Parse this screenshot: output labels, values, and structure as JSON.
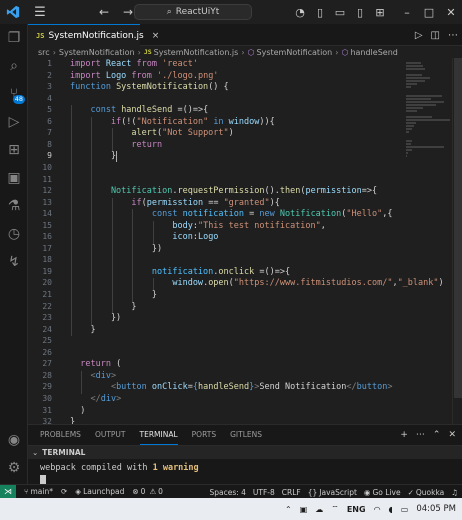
{
  "window": {
    "title": "ReactUiYt",
    "accent": "#0078d4"
  },
  "tab": {
    "lang_badge": "JS",
    "filename": "SystemNotification.js",
    "close_glyph": "×"
  },
  "breadcrumb": {
    "folder": "src",
    "file_a": "SystemNotification",
    "file_b": "SystemNotification.js",
    "fn": "SystemNotification",
    "method": "handleSend"
  },
  "activity_bar": {
    "source_control_badge": "48"
  },
  "editor": {
    "line_numbers": [
      "1",
      "2",
      "3",
      "4",
      "5",
      "6",
      "7",
      "8",
      "9",
      "10",
      "11",
      "12",
      "13",
      "14",
      "15",
      "16",
      "17",
      "18",
      "19",
      "20",
      "21",
      "22",
      "23",
      "24",
      "25",
      "26",
      "27",
      "28",
      "29",
      "30",
      "31",
      "32"
    ],
    "current_line": "9",
    "lines": [
      [
        {
          "t": "import ",
          "c": "#c586c0"
        },
        {
          "t": "React ",
          "c": "#9cdcfe"
        },
        {
          "t": "from ",
          "c": "#c586c0"
        },
        {
          "t": "'react'",
          "c": "#ce9178"
        }
      ],
      [
        {
          "t": "import ",
          "c": "#c586c0"
        },
        {
          "t": "Logo ",
          "c": "#9cdcfe"
        },
        {
          "t": "from ",
          "c": "#c586c0"
        },
        {
          "t": "'./logo.png'",
          "c": "#ce9178"
        }
      ],
      [
        {
          "t": "function ",
          "c": "#569cd6"
        },
        {
          "t": "SystemNotification",
          "c": "#dcdcaa"
        },
        {
          "t": "() {",
          "c": "#d4d4d4"
        }
      ],
      [],
      [
        {
          "t": "    const ",
          "c": "#569cd6"
        },
        {
          "t": "handleSend ",
          "c": "#dcdcaa"
        },
        {
          "t": "=()=>{",
          "c": "#d4d4d4"
        }
      ],
      [
        {
          "t": "        if",
          "c": "#c586c0"
        },
        {
          "t": "(!(",
          "c": "#d4d4d4"
        },
        {
          "t": "\"Notification\" ",
          "c": "#ce9178"
        },
        {
          "t": "in ",
          "c": "#569cd6"
        },
        {
          "t": "window",
          "c": "#9cdcfe"
        },
        {
          "t": ")){",
          "c": "#d4d4d4"
        }
      ],
      [
        {
          "t": "            alert",
          "c": "#dcdcaa"
        },
        {
          "t": "(",
          "c": "#d4d4d4"
        },
        {
          "t": "\"Not Support\"",
          "c": "#ce9178"
        },
        {
          "t": ")",
          "c": "#d4d4d4"
        }
      ],
      [
        {
          "t": "            return",
          "c": "#c586c0"
        }
      ],
      [
        {
          "t": "        }",
          "c": "#d4d4d4"
        }
      ],
      [],
      [],
      [
        {
          "t": "        Notification",
          "c": "#4ec9b0"
        },
        {
          "t": ".",
          "c": "#d4d4d4"
        },
        {
          "t": "requestPermission",
          "c": "#dcdcaa"
        },
        {
          "t": "().",
          "c": "#d4d4d4"
        },
        {
          "t": "then",
          "c": "#dcdcaa"
        },
        {
          "t": "(",
          "c": "#d4d4d4"
        },
        {
          "t": "permisstion",
          "c": "#9cdcfe"
        },
        {
          "t": "=>{",
          "c": "#d4d4d4"
        }
      ],
      [
        {
          "t": "            if",
          "c": "#c586c0"
        },
        {
          "t": "(",
          "c": "#d4d4d4"
        },
        {
          "t": "permisstion ",
          "c": "#9cdcfe"
        },
        {
          "t": "== ",
          "c": "#d4d4d4"
        },
        {
          "t": "\"granted\"",
          "c": "#ce9178"
        },
        {
          "t": "){",
          "c": "#d4d4d4"
        }
      ],
      [
        {
          "t": "                const ",
          "c": "#569cd6"
        },
        {
          "t": "notification ",
          "c": "#4fc1ff"
        },
        {
          "t": "= ",
          "c": "#d4d4d4"
        },
        {
          "t": "new ",
          "c": "#569cd6"
        },
        {
          "t": "Notification",
          "c": "#4ec9b0"
        },
        {
          "t": "(",
          "c": "#d4d4d4"
        },
        {
          "t": "\"Hello\"",
          "c": "#ce9178"
        },
        {
          "t": ",{",
          "c": "#d4d4d4"
        }
      ],
      [
        {
          "t": "                    body",
          "c": "#9cdcfe"
        },
        {
          "t": ":",
          "c": "#d4d4d4"
        },
        {
          "t": "\"This test notification\"",
          "c": "#ce9178"
        },
        {
          "t": ",",
          "c": "#d4d4d4"
        }
      ],
      [
        {
          "t": "                    icon",
          "c": "#9cdcfe"
        },
        {
          "t": ":",
          "c": "#d4d4d4"
        },
        {
          "t": "Logo",
          "c": "#9cdcfe"
        }
      ],
      [
        {
          "t": "                })",
          "c": "#d4d4d4"
        }
      ],
      [],
      [
        {
          "t": "                notification",
          "c": "#4fc1ff"
        },
        {
          "t": ".",
          "c": "#d4d4d4"
        },
        {
          "t": "onclick ",
          "c": "#dcdcaa"
        },
        {
          "t": "=()=>{",
          "c": "#d4d4d4"
        }
      ],
      [
        {
          "t": "                    window",
          "c": "#9cdcfe"
        },
        {
          "t": ".",
          "c": "#d4d4d4"
        },
        {
          "t": "open",
          "c": "#dcdcaa"
        },
        {
          "t": "(",
          "c": "#d4d4d4"
        },
        {
          "t": "\"https://www.fitmistudios.com/\"",
          "c": "#ce9178"
        },
        {
          "t": ",",
          "c": "#d4d4d4"
        },
        {
          "t": "\"_blank\"",
          "c": "#ce9178"
        },
        {
          "t": ")",
          "c": "#d4d4d4"
        }
      ],
      [
        {
          "t": "                }",
          "c": "#d4d4d4"
        }
      ],
      [
        {
          "t": "            }",
          "c": "#d4d4d4"
        }
      ],
      [
        {
          "t": "        })",
          "c": "#d4d4d4"
        }
      ],
      [
        {
          "t": "    }",
          "c": "#d4d4d4"
        }
      ],
      [],
      [],
      [
        {
          "t": "  return ",
          "c": "#c586c0"
        },
        {
          "t": "(",
          "c": "#d4d4d4"
        }
      ],
      [
        {
          "t": "    <",
          "c": "#808080"
        },
        {
          "t": "div",
          "c": "#569cd6"
        },
        {
          "t": ">",
          "c": "#808080"
        }
      ],
      [
        {
          "t": "        <",
          "c": "#808080"
        },
        {
          "t": "button ",
          "c": "#569cd6"
        },
        {
          "t": "onClick",
          "c": "#9cdcfe"
        },
        {
          "t": "=",
          "c": "#d4d4d4"
        },
        {
          "t": "{",
          "c": "#569cd6"
        },
        {
          "t": "handleSend",
          "c": "#dcdcaa"
        },
        {
          "t": "}",
          "c": "#569cd6"
        },
        {
          "t": ">",
          "c": "#808080"
        },
        {
          "t": "Send Notification",
          "c": "#d4d4d4"
        },
        {
          "t": "</",
          "c": "#808080"
        },
        {
          "t": "button",
          "c": "#569cd6"
        },
        {
          "t": ">",
          "c": "#808080"
        }
      ],
      [
        {
          "t": "    </",
          "c": "#808080"
        },
        {
          "t": "div",
          "c": "#569cd6"
        },
        {
          "t": ">",
          "c": "#808080"
        }
      ],
      [
        {
          "t": "  )",
          "c": "#d4d4d4"
        }
      ],
      [
        {
          "t": "}",
          "c": "#d4d4d4"
        }
      ]
    ]
  },
  "panel": {
    "tabs": [
      "PROBLEMS",
      "OUTPUT",
      "TERMINAL",
      "PORTS",
      "GITLENS"
    ],
    "active_tab": "TERMINAL",
    "terminal_header": "TERMINAL",
    "terminal_text_prefix": "webpack compiled with ",
    "terminal_warning": "1 warning"
  },
  "statusbar": {
    "branch": "main*",
    "launchpad": "Launchpad",
    "errors": "0",
    "warnings": "0",
    "spaces": "Spaces: 4",
    "encoding": "UTF-8",
    "eol": "CRLF",
    "language": "JavaScript",
    "go_live": "Go Live",
    "quokka": "Quokka"
  },
  "taskbar": {
    "lang": "ENG",
    "time": "04:05 PM"
  }
}
